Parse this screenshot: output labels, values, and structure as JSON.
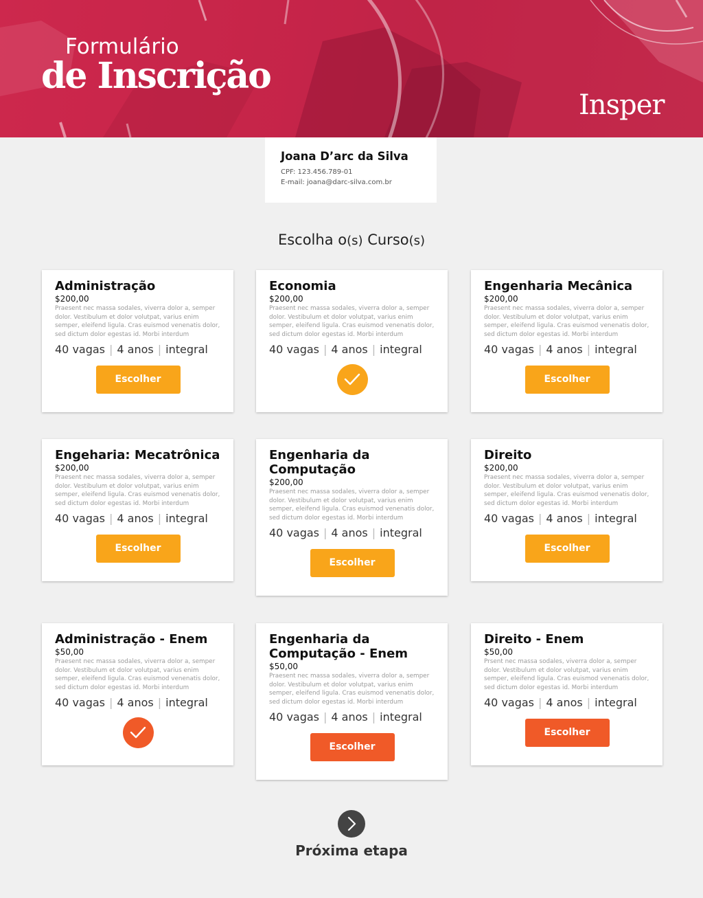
{
  "header": {
    "title_line1": "Formulário",
    "title_line2": "de Inscrição",
    "logo_text": "Insper",
    "banner_color": "#c9264a"
  },
  "user": {
    "name": "Joana D’arc da Silva",
    "cpf": "CPF: 123.456.789-01",
    "email": "E-mail: joana@darc-silva.com.br"
  },
  "section": {
    "title_a": "Escolha o",
    "title_b": "(s)",
    "title_c": " Curso",
    "title_d": "(s)"
  },
  "colors": {
    "accent_yellow": "#f9a51a",
    "accent_orange": "#f05a28",
    "next_button": "#444444"
  },
  "button_label": "Escolher",
  "courses": [
    {
      "name": "Administração",
      "price": "$200,00",
      "desc": "Praesent nec massa sodales, viverra dolor a, semper dolor. Vestibulum et dolor volutpat, varius enim semper, eleifend ligula. Cras euismod venenatis dolor, sed dictum dolor egestas id. Morbi interdum",
      "vagas": "40 vagas",
      "duracao": "4 anos",
      "periodo": "integral",
      "selected": false,
      "color": "yellow"
    },
    {
      "name": "Economia",
      "price": "$200,00",
      "desc": "Praesent nec massa sodales, viverra dolor a, semper dolor. Vestibulum et dolor volutpat, varius enim semper, eleifend ligula. Cras euismod venenatis dolor, sed dictum dolor egestas id. Morbi interdum",
      "vagas": "40 vagas",
      "duracao": "4 anos",
      "periodo": "integral",
      "selected": true,
      "color": "yellow"
    },
    {
      "name": "Engenharia Mecânica",
      "price": "$200,00",
      "desc": "Praesent nec massa sodales, viverra dolor a, semper dolor. Vestibulum et dolor volutpat, varius enim semper, eleifend ligula. Cras euismod venenatis dolor, sed dictum dolor egestas id. Morbi interdum",
      "vagas": "40 vagas",
      "duracao": "4 anos",
      "periodo": "integral",
      "selected": false,
      "color": "yellow"
    },
    {
      "name": "Engeharia: Mecatrônica",
      "price": "$200,00",
      "desc": "Praesent nec massa sodales, viverra dolor a, semper dolor. Vestibulum et dolor volutpat, varius enim semper, eleifend ligula. Cras euismod venenatis dolor, sed dictum dolor egestas id. Morbi interdum",
      "vagas": "40 vagas",
      "duracao": "4 anos",
      "periodo": "integral",
      "selected": false,
      "color": "yellow"
    },
    {
      "name": "Engenharia da Computação",
      "price": "$200,00",
      "desc": "Praesent nec massa sodales, viverra dolor a, semper dolor. Vestibulum et dolor volutpat, varius enim semper, eleifend ligula. Cras euismod venenatis dolor, sed dictum dolor egestas id. Morbi interdum",
      "vagas": "40 vagas",
      "duracao": "4 anos",
      "periodo": "integral",
      "selected": false,
      "color": "yellow"
    },
    {
      "name": "Direito",
      "price": "$200,00",
      "desc": "Praesent nec massa sodales, viverra dolor a, semper dolor. Vestibulum et dolor volutpat, varius enim semper, eleifend ligula. Cras euismod venenatis dolor, sed dictum dolor egestas id. Morbi interdum",
      "vagas": "40 vagas",
      "duracao": "4 anos",
      "periodo": "integral",
      "selected": false,
      "color": "yellow"
    },
    {
      "name": "Administração - Enem",
      "price": "$50,00",
      "desc": "Praesent nec massa sodales, viverra dolor a, semper dolor. Vestibulum et dolor volutpat, varius enim semper, eleifend ligula. Cras euismod venenatis dolor, sed dictum dolor egestas id. Morbi interdum",
      "vagas": "40 vagas",
      "duracao": "4 anos",
      "periodo": "integral",
      "selected": true,
      "color": "orange"
    },
    {
      "name": "Engenharia da Computação - Enem",
      "price": "$50,00",
      "desc": "Praesent nec massa sodales, viverra dolor a, semper dolor. Vestibulum et dolor volutpat, varius enim semper, eleifend ligula. Cras euismod venenatis dolor, sed dictum dolor egestas id. Morbi interdum",
      "vagas": "40 vagas",
      "duracao": "4 anos",
      "periodo": "integral",
      "selected": false,
      "color": "orange"
    },
    {
      "name": "Direito - Enem",
      "price": "$50,00",
      "desc": "Prsent nec massa sodales, viverra dolor a, semper dolor. Vestibulum et dolor volutpat, varius enim semper, eleifend ligula. Cras euismod venenatis dolor, sed dictum dolor egestas id. Morbi interdum",
      "vagas": "40 vagas",
      "duracao": "4 anos",
      "periodo": "integral",
      "selected": false,
      "color": "orange"
    }
  ],
  "next": {
    "label": "Próxima etapa",
    "icon": "chevron-right-icon"
  }
}
